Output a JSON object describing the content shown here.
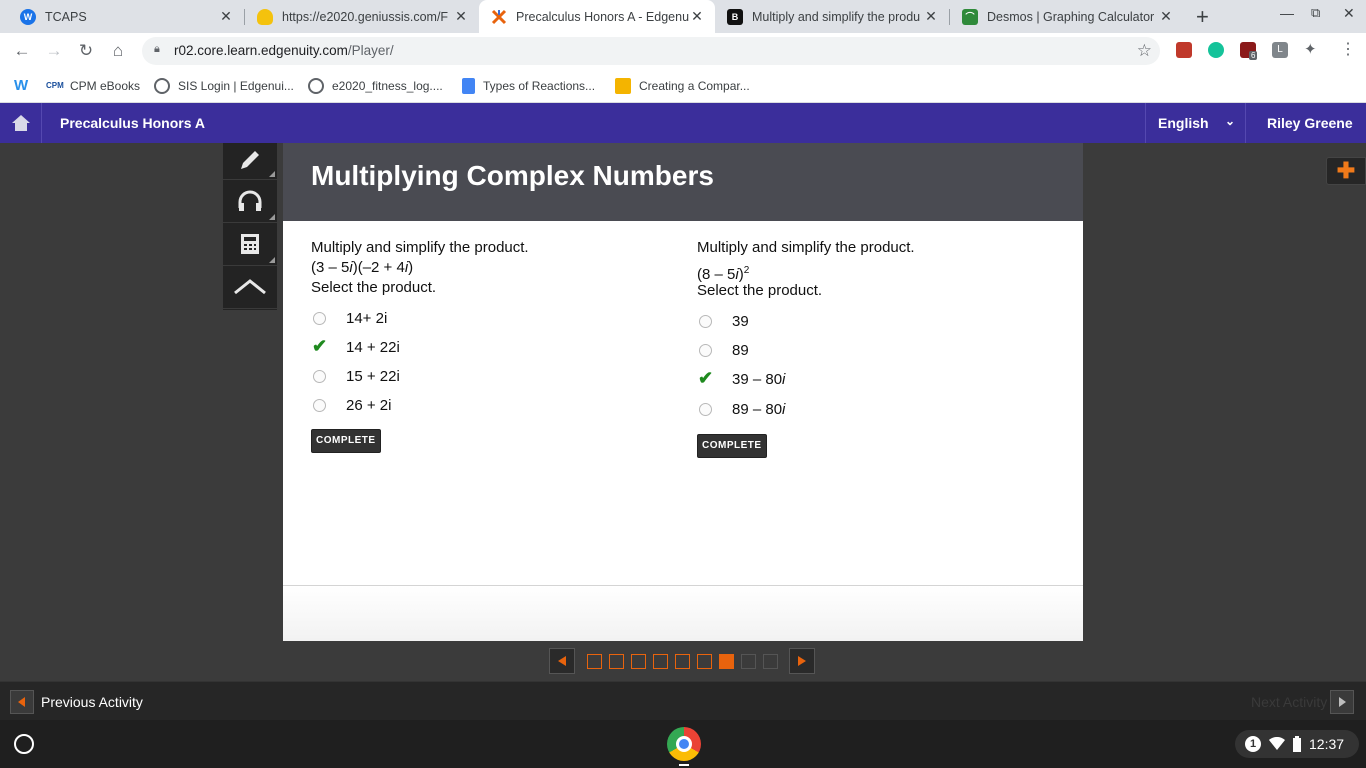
{
  "browser": {
    "tabs": [
      {
        "title": "TCAPS",
        "icon": "tcaps-icon",
        "color": "#1a73e8"
      },
      {
        "title": "https://e2020.geniussis.com/F",
        "icon": "lightbulb-icon",
        "color": "#f4c20d"
      },
      {
        "title": "Precalculus Honors A - Edgenuit",
        "icon": "edgenuity-icon",
        "color": "#e8630d"
      },
      {
        "title": "Multiply and simplify the produ",
        "icon": "brainly-icon",
        "color": "#111111"
      },
      {
        "title": "Desmos | Graphing Calculator",
        "icon": "desmos-icon",
        "color": "#2f8a3a"
      }
    ],
    "url_host": "r02.core.learn.edgenuity.com",
    "url_path": "/Player/",
    "bookmarks": [
      {
        "label": "",
        "icon": "weebly-icon",
        "color": "#2990ea"
      },
      {
        "label": "CPM eBooks",
        "icon": "cpm-icon",
        "color": "#1a4f9c"
      },
      {
        "label": "SIS Login | Edgenui...",
        "icon": "globe-icon",
        "color": "#5f6368"
      },
      {
        "label": "e2020_fitness_log....",
        "icon": "globe-icon",
        "color": "#5f6368"
      },
      {
        "label": "Types of Reactions...",
        "icon": "docs-icon",
        "color": "#4285f4"
      },
      {
        "label": "Creating a Compar...",
        "icon": "slides-icon",
        "color": "#f4b400"
      }
    ],
    "extension_badge": "6"
  },
  "app": {
    "course_title": "Precalculus Honors A",
    "language": "English",
    "user_name": "Riley Greene",
    "colors": {
      "header": "#3b2e9b",
      "accent": "#e8630d",
      "check": "#1f8a1f"
    }
  },
  "activity": {
    "title": "Multiplying Complex Numbers",
    "questions": [
      {
        "instruction": "Multiply and simplify the product.",
        "expression_a": "(3 – 5",
        "expression_i1": "i",
        "expression_b": ")(–2 + 4",
        "expression_i2": "i",
        "expression_c": ")",
        "select_text": "Select the product.",
        "options": [
          "14+ 2i",
          "14 + 22i",
          "15 + 22i",
          "26 + 2i"
        ],
        "correct_index": 1,
        "status": "COMPLETE"
      },
      {
        "instruction": "Multiply and simplify the product.",
        "expression_a": "(8 – 5",
        "expression_i1": "i",
        "expression_b": ")",
        "exponent": "2",
        "select_text": "Select the product.",
        "options": [
          "39",
          "89",
          "39 – 80",
          "89 – 80"
        ],
        "option_suffix_italic": [
          "",
          "",
          "i",
          "i"
        ],
        "correct_index": 2,
        "status": "COMPLETE"
      }
    ],
    "pages": {
      "total": 9,
      "current": 7,
      "completed_through": 6
    }
  },
  "footer": {
    "previous_label": "Previous Activity",
    "next_label": "Next Activity"
  },
  "system": {
    "notification_count": "1",
    "time": "12:37"
  }
}
